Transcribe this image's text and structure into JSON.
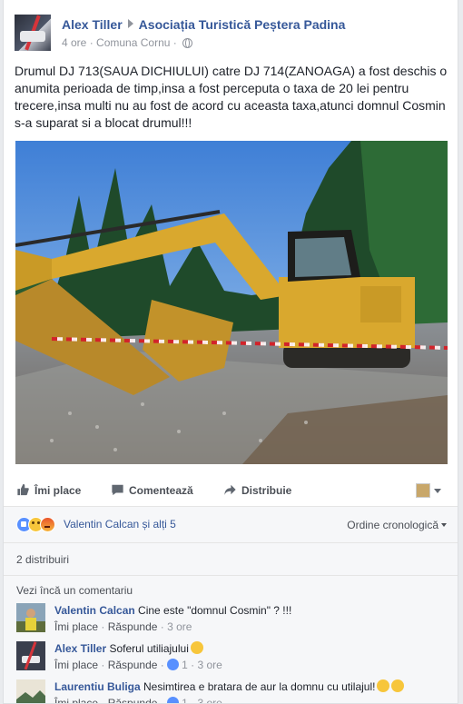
{
  "post": {
    "author": "Alex Tiller",
    "target": "Asociația Turistică Peștera Padina",
    "time": "4 ore",
    "separator": "·",
    "location": "Comuna Cornu",
    "separator2": "·",
    "text": "Drumul DJ 713(SAUA DICHIULUI) catre DJ 714(ZANOAGA) a fost deschis o anumita perioada de timp,insa a fost perceputa o taxa de 20 lei pentru trecere,insa multi nu au fost de acord cu aceasta taxa,atunci domnul Cosmin s-a suparat si a blocat drumul!!!"
  },
  "actions": {
    "like": "Îmi place",
    "comment": "Comentează",
    "share": "Distribuie"
  },
  "reactions": {
    "names": "Valentin Calcan și alți 5",
    "sort": "Ordine cronologică"
  },
  "shares": "2 distribuiri",
  "comments": {
    "more": "Vezi încă un comentariu",
    "items": [
      {
        "name": "Valentin Calcan",
        "text": "Cine este \"domnul Cosmin\" ? !!!",
        "like": "Îmi place",
        "sep": "·",
        "reply": "Răspunde",
        "sep2": "·",
        "time": "3 ore",
        "likes": ""
      },
      {
        "name": "Alex Tiller",
        "text": "Soferul utiliajului",
        "like": "Îmi place",
        "sep": "·",
        "reply": "Răspunde",
        "sep2": "·",
        "likes": "1",
        "sep3": "·",
        "time": "3 ore"
      },
      {
        "name": "Laurentiu Buliga",
        "text": "Nesimtirea e bratara de aur la domnu cu utilajul!",
        "like": "Îmi place",
        "sep": "·",
        "reply": "Răspunde",
        "sep2": "·",
        "likes": "1",
        "sep3": "·",
        "time": "3 ore"
      }
    ]
  },
  "colors": {
    "link": "#365899",
    "like_blue": "#5890ff",
    "machine_yellow": "#d9a82e"
  },
  "icons": {
    "like": "thumbs-up-icon",
    "comment": "speech-bubble-icon",
    "share": "share-arrow-icon",
    "privacy": "globe-icon"
  }
}
